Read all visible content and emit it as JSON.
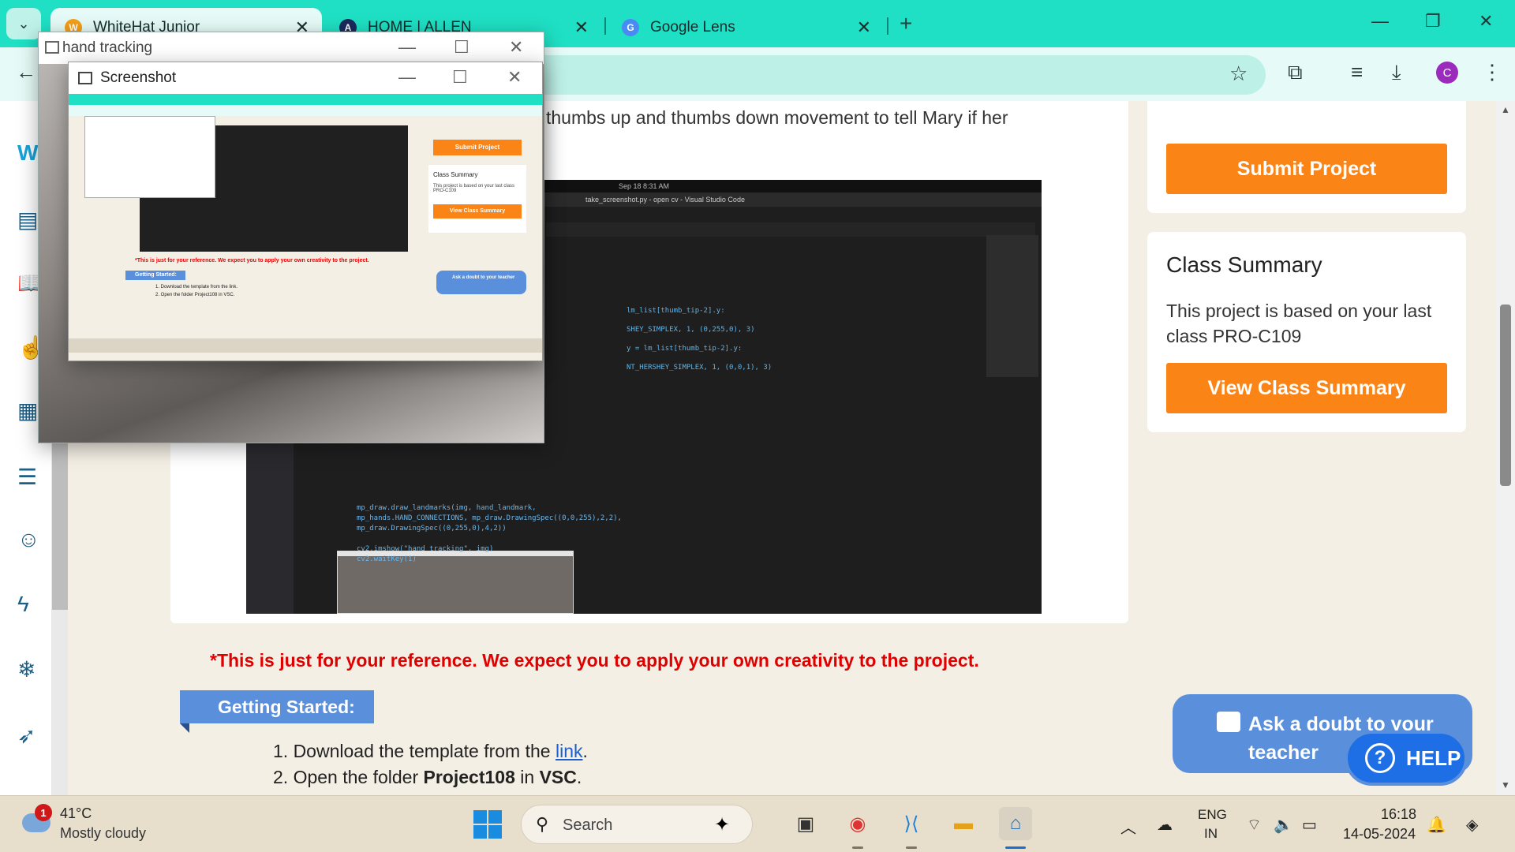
{
  "browser": {
    "tabs": [
      {
        "label": "WhiteHat Junior",
        "active": true,
        "icon": "whitehat-favicon"
      },
      {
        "label": "HOME | ALLEN",
        "active": false,
        "icon": "allen-favicon"
      },
      {
        "label": "Google Lens",
        "active": false,
        "icon": "google-lens-favicon"
      }
    ],
    "address_fragment": "3"
  },
  "page": {
    "intro_text": "thumbs up and thumbs down movement to tell Mary if her",
    "note": "*This is just for your reference. We expect you to apply your own creativity to the project.",
    "getting_started": "Getting Started:",
    "steps": {
      "s1_prefix": "1. Download the template from the ",
      "s1_link": "link",
      "s1_suffix": ".",
      "s2_prefix": "2. Open the folder ",
      "s2_folder": "Project108",
      "s2_mid": " in ",
      "s2_app": "VSC",
      "s2_suffix": "."
    }
  },
  "sidebar_right": {
    "submit_label": "Submit Project",
    "summary_title": "Class Summary",
    "summary_text": "This project is based on your last class PRO-C109",
    "view_summary_label": "View Class Summary"
  },
  "ask_doubt": {
    "label": "Ask a doubt to your teacher",
    "help_label": "HELP"
  },
  "windows": {
    "hand_tracking_title": "hand tracking",
    "screenshot_title": "Screenshot"
  },
  "embedded_screenshot": {
    "top_bar": "Sep 18 8:31 AM",
    "title_bar": "take_screenshot.py - open cv - Visual Studio Code",
    "code_right": "lm_list[thumb_tip-2].y:\n\nSHEY_SIMPLEX, 1, (0,255,0), 3)\n\ny = lm_list[thumb_tip-2].y:\n\nNT_HERSHEY_SIMPLEX, 1, (0,0,1), 3)",
    "code_bottom": "mp_draw.draw_landmarks(img, hand_landmark,\nmp_hands.HAND_CONNECTIONS, mp_draw.DrawingSpec((0,0,255),2,2),\nmp_draw.DrawingSpec((0,255,0),4,2))\n\ncv2.imshow(\"hand tracking\", img)\ncv2.waitKey(1)"
  },
  "mini_page": {
    "submit": "Submit Project",
    "cs_title": "Class Summary",
    "cs_text": "This project is based on your last class PRO-C109",
    "view": "View Class Summary",
    "note": "*This is just for your reference. We expect you to apply your own creativity to the project.",
    "gs": "Getting Started:",
    "steps": "1. Download the template from the link.\n2. Open the folder Project108 in VSC.",
    "ask": "Ask a doubt to your teacher"
  },
  "taskbar": {
    "weather_temp": "41°C",
    "weather_desc": "Mostly cloudy",
    "weather_badge": "1",
    "search_placeholder": "Search",
    "lang_line1": "ENG",
    "lang_line2": "IN",
    "time": "16:18",
    "date": "14-05-2024"
  },
  "colors": {
    "tab_strip": "#1fe0c4",
    "accent_orange": "#fb8417",
    "help_blue": "#5a8fdb",
    "note_red": "#e00000"
  }
}
